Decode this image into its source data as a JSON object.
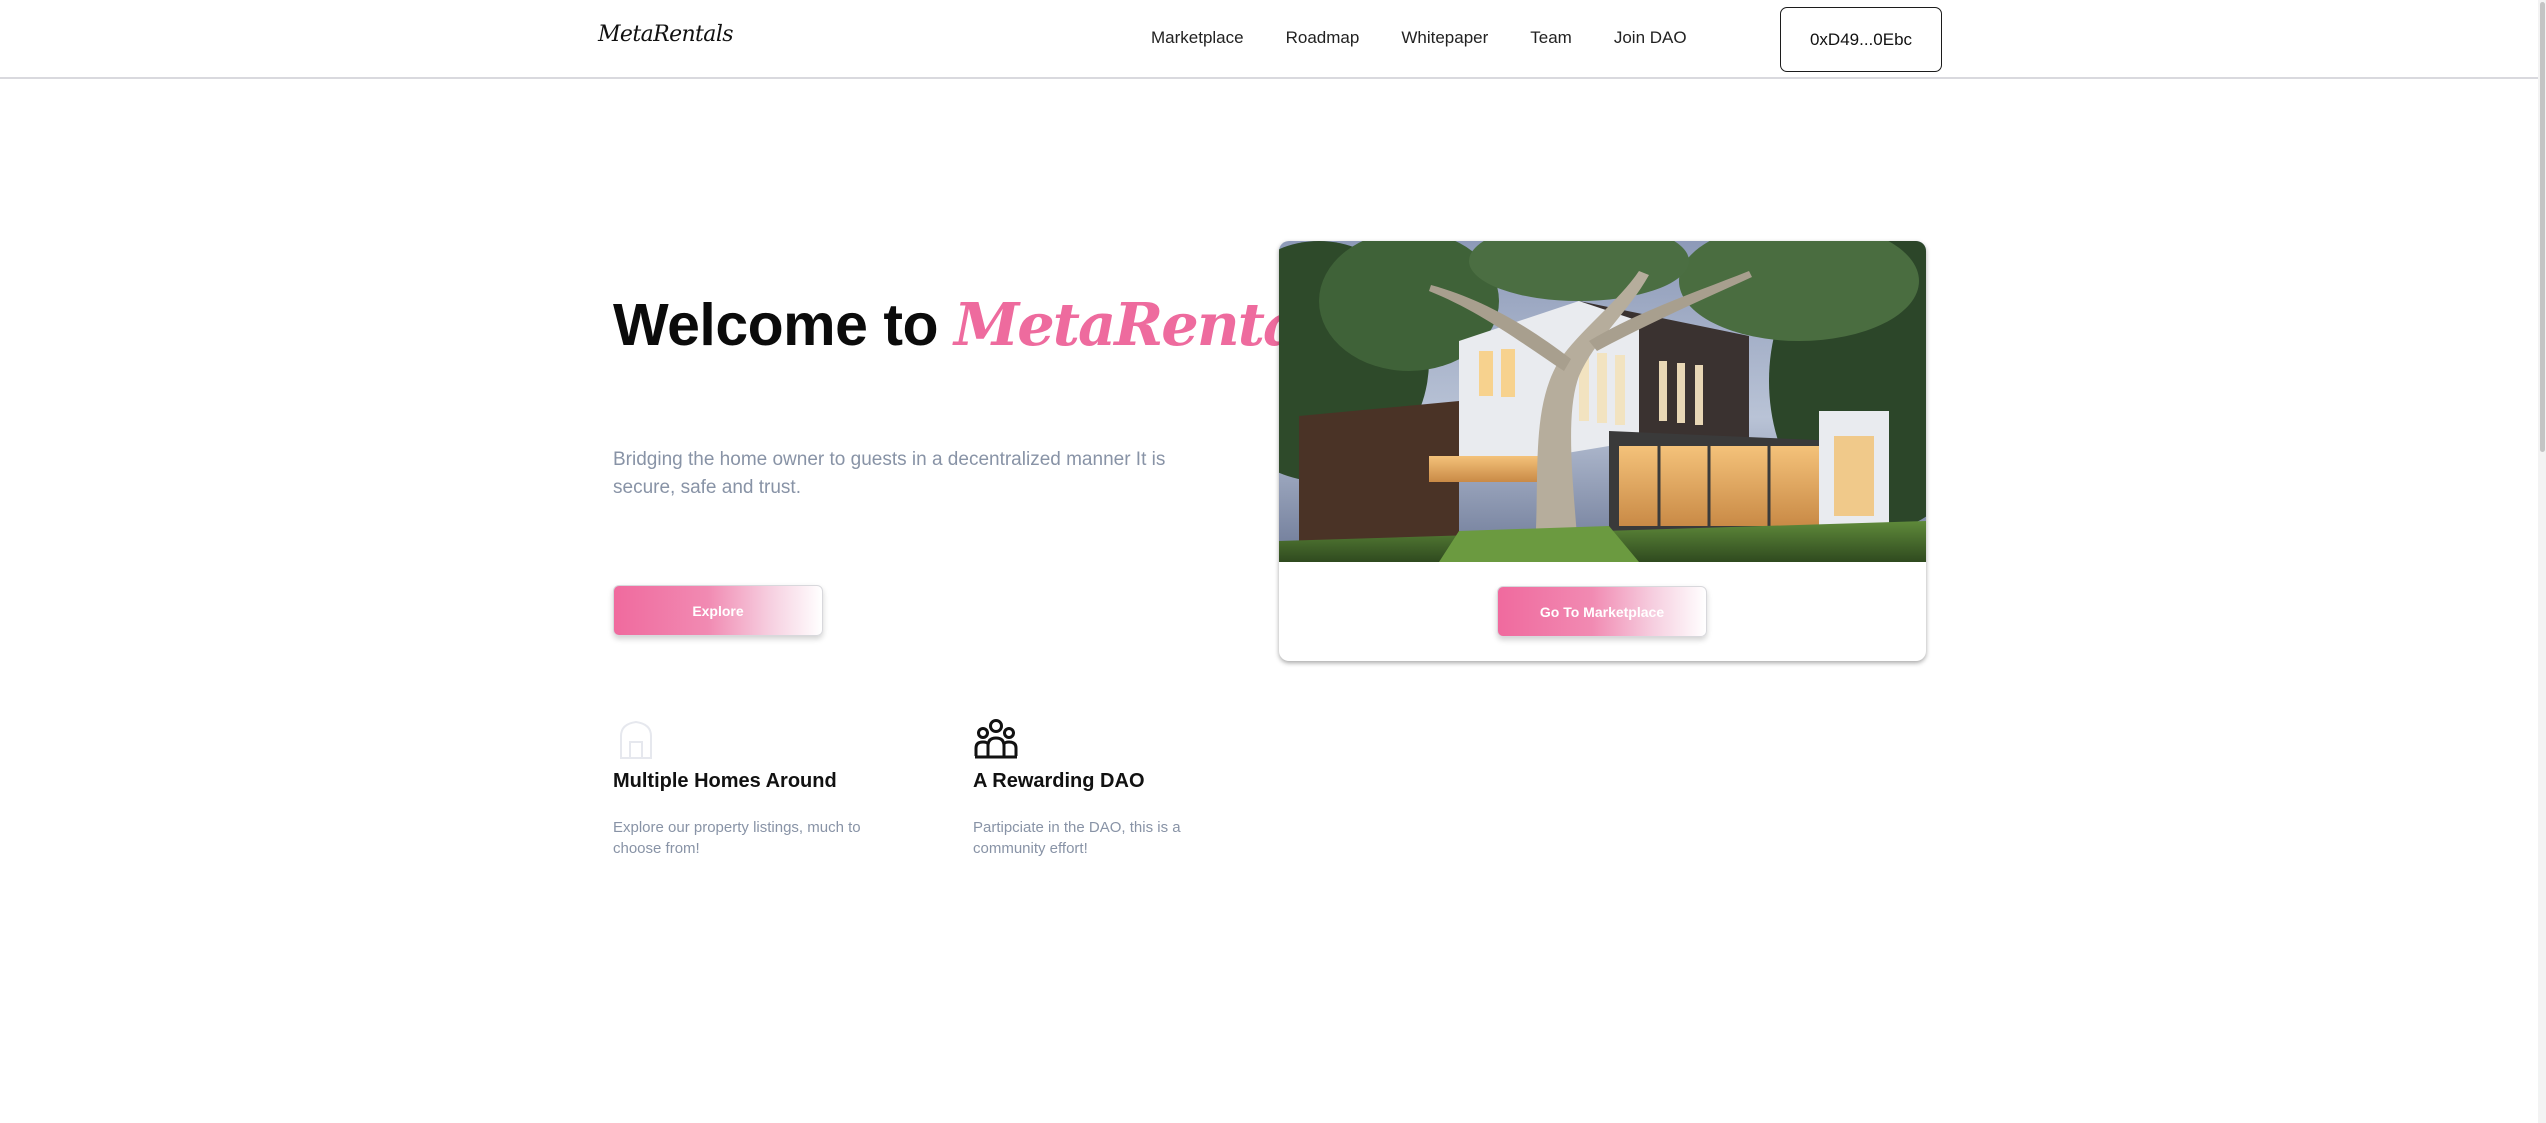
{
  "header": {
    "logo": "MetaRentals",
    "nav": [
      {
        "label": "Marketplace"
      },
      {
        "label": "Roadmap"
      },
      {
        "label": "Whitepaper"
      },
      {
        "label": "Team"
      },
      {
        "label": "Join DAO"
      }
    ],
    "wallet_label": "0xD49...0Ebc"
  },
  "hero": {
    "title_prefix": "Welcome to ",
    "title_brand": "MetaRentals",
    "description": "Bridging the home owner to guests in a decentralized manner It is secure, safe and trust.",
    "explore_label": "Explore"
  },
  "card": {
    "image_icon": "modern-house-photo",
    "button_label": "Go To Marketplace"
  },
  "features": [
    {
      "icon": "home-icon",
      "title": "Multiple Homes Around",
      "text": "Explore our property listings, much to choose from!"
    },
    {
      "icon": "group-icon",
      "title": "A Rewarding DAO",
      "text": "Partipciate in the DAO, this is a community effort!"
    }
  ],
  "colors": {
    "brand_pink": "#ee6b9e",
    "muted_text": "#8893a6"
  }
}
